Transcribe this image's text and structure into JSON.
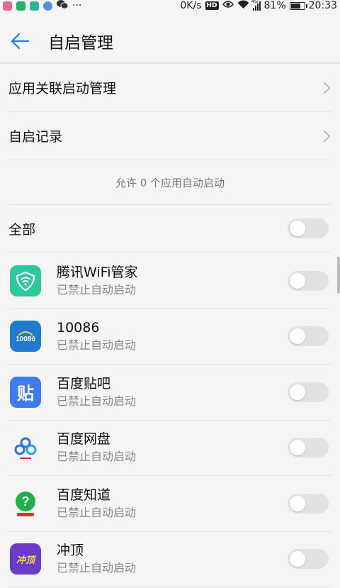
{
  "status_bar": {
    "speed": "0K/s",
    "hd": "HD",
    "network": "4G",
    "battery": "81%",
    "battery_level": 0.81,
    "time": "20:33",
    "dots": "···"
  },
  "header": {
    "title": "自启管理"
  },
  "menu": {
    "linked_start": "应用关联启动管理",
    "start_log": "自启记录"
  },
  "summary": "允许 0 个应用自动启动",
  "all_label": "全部",
  "apps": [
    {
      "name": "腾讯WiFi管家",
      "status": "已禁止自动启动"
    },
    {
      "name": "10086",
      "status": "已禁止自动启动"
    },
    {
      "name": "百度贴吧",
      "status": "已禁止自动启动"
    },
    {
      "name": "百度网盘",
      "status": "已禁止自动启动"
    },
    {
      "name": "百度知道",
      "status": "已禁止自动启动"
    },
    {
      "name": "冲顶",
      "status": "已禁止自动启动"
    }
  ],
  "icon_text": {
    "mobile": "10086",
    "tieba": "贴",
    "chongding": "冲顶"
  },
  "colors": {
    "accent": "#1e7ce0",
    "toggle_off": "#e2e2e2"
  }
}
